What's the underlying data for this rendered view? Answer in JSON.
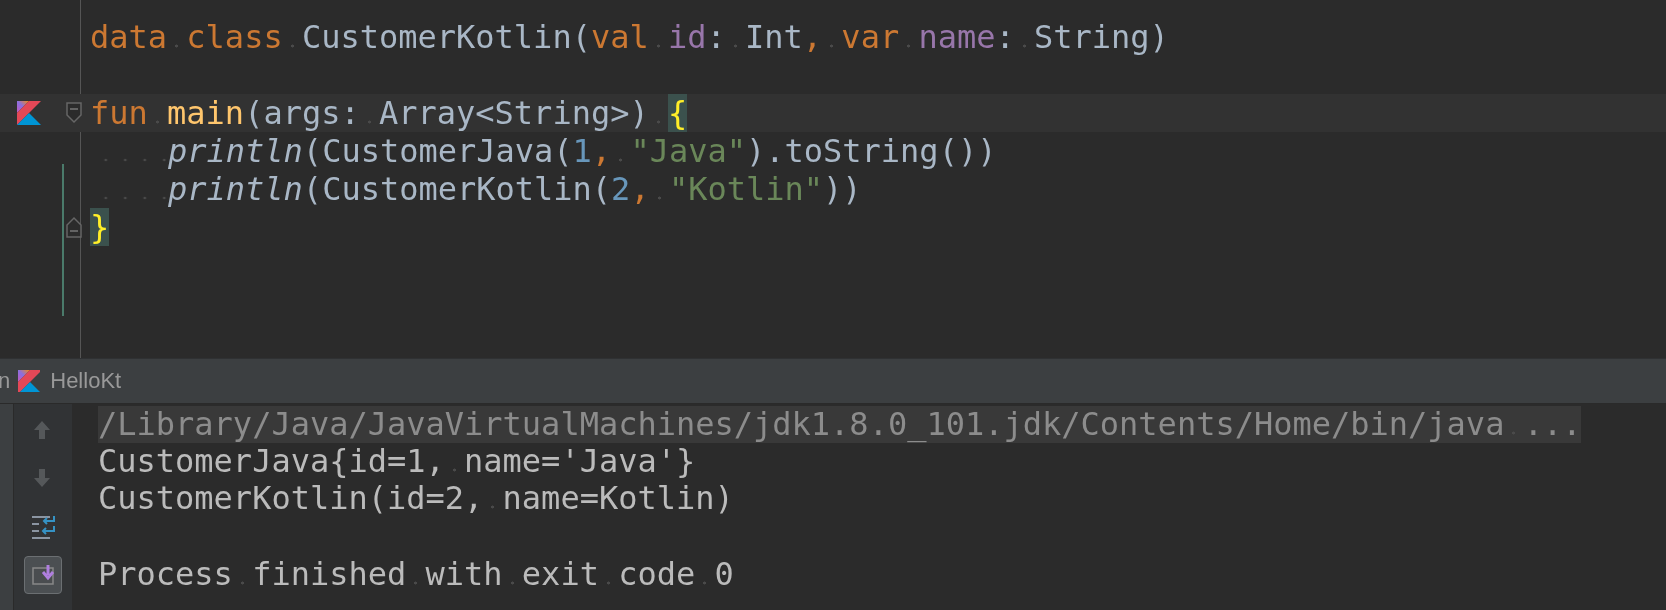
{
  "editor": {
    "lines": [
      {
        "kind": "code",
        "current": false,
        "indented": false,
        "tokens": [
          {
            "kind": "keyword",
            "text": "data class "
          },
          {
            "kind": "plain",
            "text": "CustomerKotlin("
          },
          {
            "kind": "keyword",
            "text": "val "
          },
          {
            "kind": "param",
            "text": "id"
          },
          {
            "kind": "plain",
            "text": ": Int"
          },
          {
            "kind": "keyword",
            "text": ", var "
          },
          {
            "kind": "param",
            "text": "name"
          },
          {
            "kind": "plain",
            "text": ": String)"
          }
        ]
      },
      {
        "kind": "blank",
        "current": false,
        "indented": false
      },
      {
        "kind": "fun-start",
        "current": true,
        "indented": false,
        "tokens": [
          {
            "kind": "keyword",
            "text": "fun "
          },
          {
            "kind": "function",
            "text": "main"
          },
          {
            "kind": "plain",
            "text": "(args: Array<String>) "
          },
          {
            "kind": "brace",
            "text": "{"
          }
        ]
      },
      {
        "kind": "code",
        "current": false,
        "indented": true,
        "tokens": [
          {
            "kind": "call",
            "text": "println"
          },
          {
            "kind": "plain",
            "text": "(CustomerJava("
          },
          {
            "kind": "number",
            "text": "1"
          },
          {
            "kind": "keyword",
            "text": ", "
          },
          {
            "kind": "string",
            "text": "\"Java\""
          },
          {
            "kind": "plain",
            "text": ").toString())"
          }
        ]
      },
      {
        "kind": "code",
        "current": false,
        "indented": true,
        "tokens": [
          {
            "kind": "call",
            "text": "println"
          },
          {
            "kind": "plain",
            "text": "(CustomerKotlin("
          },
          {
            "kind": "number",
            "text": "2"
          },
          {
            "kind": "keyword",
            "text": ", "
          },
          {
            "kind": "string",
            "text": "\"Kotlin\""
          },
          {
            "kind": "plain",
            "text": "))"
          }
        ]
      },
      {
        "kind": "fold-end",
        "current": false,
        "indented": false,
        "tokens": [
          {
            "kind": "brace",
            "text": "}"
          }
        ]
      }
    ]
  },
  "run_panel": {
    "tab_cut": "n",
    "config": "HelloKt",
    "toolbar": [
      {
        "kind": "up",
        "disabled": true,
        "selected": false
      },
      {
        "kind": "down",
        "disabled": true,
        "selected": false
      },
      {
        "kind": "wrap",
        "disabled": false,
        "selected": false
      },
      {
        "kind": "scroll-end",
        "disabled": false,
        "selected": true
      }
    ],
    "console": [
      {
        "kind": "command",
        "text": "/Library/Java/JavaVirtualMachines/jdk1.8.0_101.jdk/Contents/Home/bin/java ..."
      },
      {
        "kind": "output",
        "text": "CustomerJava{id=1, name='Java'}"
      },
      {
        "kind": "output",
        "text": "CustomerKotlin(id=2, name=Kotlin)"
      },
      {
        "kind": "exit",
        "text": "Process finished with exit code 0"
      }
    ]
  }
}
